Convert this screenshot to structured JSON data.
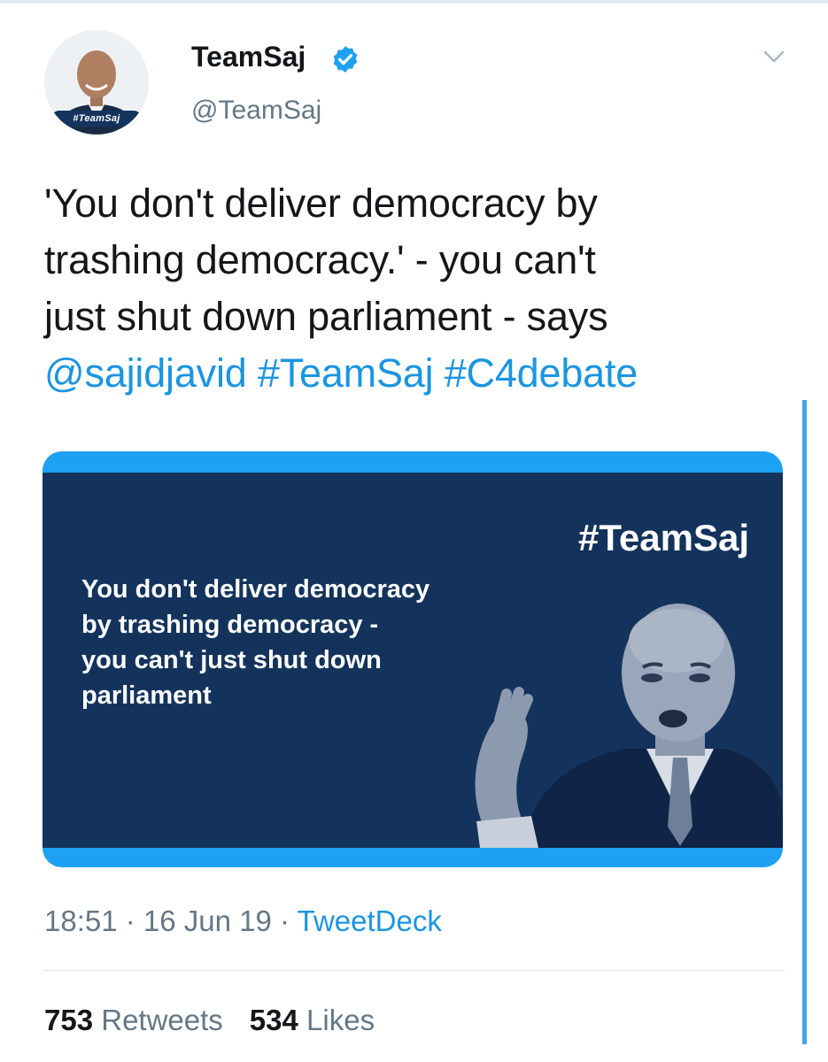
{
  "account": {
    "display_name": "TeamSaj",
    "handle": "@TeamSaj",
    "avatar_tag": "#TeamSaj"
  },
  "tweet": {
    "lines": [
      "'You don't deliver democracy by",
      "trashing democracy.' - you can't",
      "just shut down parliament - says"
    ],
    "mention": "@sajidjavid",
    "hashtags": [
      "#TeamSaj",
      "#C4debate"
    ]
  },
  "media": {
    "tag": "#TeamSaj",
    "quote_lines": [
      "You don't deliver democracy",
      "by trashing democracy -",
      "you can't just shut down",
      "parliament"
    ]
  },
  "meta": {
    "time": "18:51",
    "sep1": " · ",
    "date": "16 Jun 19",
    "sep2": " · ",
    "source": "TweetDeck"
  },
  "stats": {
    "retweets_count": "753",
    "retweets_label": "Retweets",
    "likes_count": "534",
    "likes_label": "Likes"
  },
  "colors": {
    "link": "#1b95e0",
    "verified": "#1da1f2",
    "card_border": "#1da1f2",
    "card_background": "#14335c"
  }
}
